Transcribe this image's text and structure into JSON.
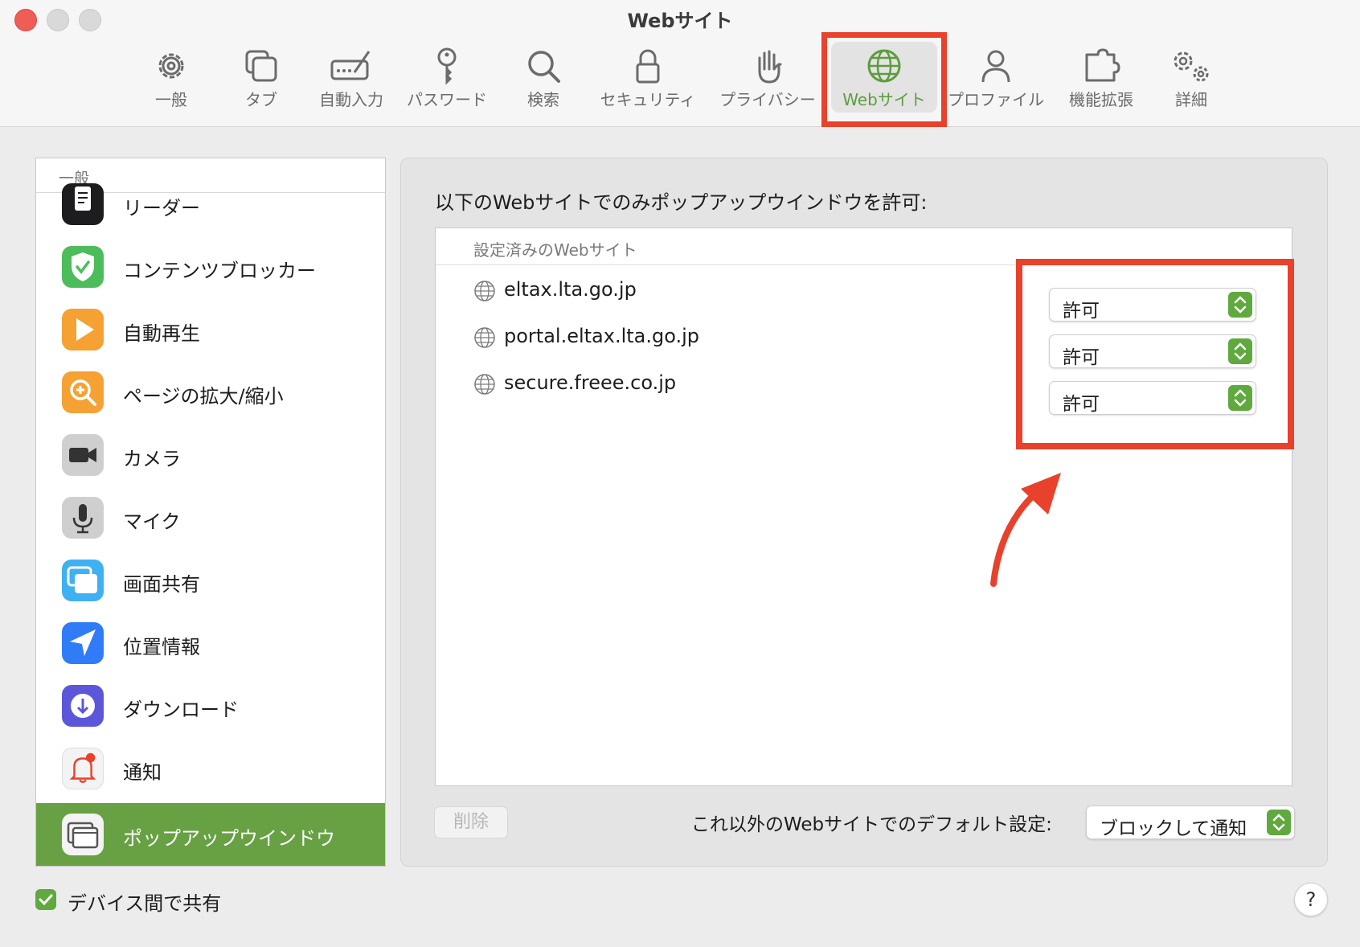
{
  "window": {
    "title": "Webサイト"
  },
  "toolbar": {
    "items": [
      {
        "label": "一般",
        "icon": "gear-icon"
      },
      {
        "label": "タブ",
        "icon": "tabs-icon"
      },
      {
        "label": "自動入力",
        "icon": "autofill-icon"
      },
      {
        "label": "パスワード",
        "icon": "key-icon"
      },
      {
        "label": "検索",
        "icon": "search-icon"
      },
      {
        "label": "セキュリティ",
        "icon": "lock-icon"
      },
      {
        "label": "プライバシー",
        "icon": "hand-icon"
      },
      {
        "label": "Webサイト",
        "icon": "globe-icon",
        "active": true
      },
      {
        "label": "プロファイル",
        "icon": "person-icon"
      },
      {
        "label": "機能拡張",
        "icon": "puzzle-icon"
      },
      {
        "label": "詳細",
        "icon": "gears-icon"
      }
    ]
  },
  "sidebar": {
    "section_header": "一般",
    "items": [
      {
        "label": "リーダー",
        "icon": "reader-icon"
      },
      {
        "label": "コンテンツブロッカー",
        "icon": "shield-check-icon"
      },
      {
        "label": "自動再生",
        "icon": "play-icon"
      },
      {
        "label": "ページの拡大/縮小",
        "icon": "zoom-icon"
      },
      {
        "label": "カメラ",
        "icon": "camera-icon"
      },
      {
        "label": "マイク",
        "icon": "microphone-icon"
      },
      {
        "label": "画面共有",
        "icon": "screen-share-icon"
      },
      {
        "label": "位置情報",
        "icon": "location-icon"
      },
      {
        "label": "ダウンロード",
        "icon": "download-icon"
      },
      {
        "label": "通知",
        "icon": "bell-icon"
      },
      {
        "label": "ポップアップウインドウ",
        "icon": "popup-window-icon",
        "selected": true
      }
    ]
  },
  "main": {
    "heading": "以下のWebサイトでのみポップアップウインドウを許可:",
    "table_header": "設定済みのWebサイト",
    "sites": [
      {
        "domain": "eltax.lta.go.jp",
        "setting": "許可"
      },
      {
        "domain": "portal.eltax.lta.go.jp",
        "setting": "許可"
      },
      {
        "domain": "secure.freee.co.jp",
        "setting": "許可"
      }
    ],
    "delete_button": "削除",
    "default_label": "これ以外のWebサイトでのデフォルト設定:",
    "default_value": "ブロックして通知"
  },
  "footer": {
    "share_label": "デバイス間で共有",
    "help": "?"
  },
  "colors": {
    "accent_green": "#5fa93e",
    "selected_row": "#67a144",
    "annotation_red": "#e8412c"
  }
}
